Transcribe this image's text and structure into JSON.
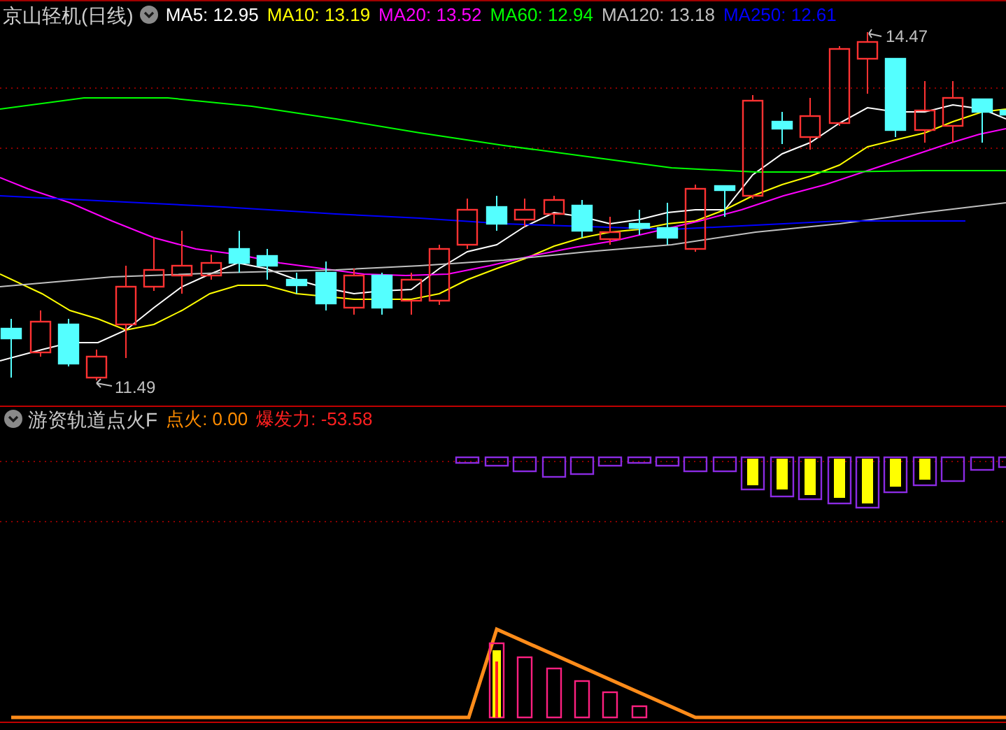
{
  "main_chart": {
    "title": "京山轻机(日线)",
    "moving_averages": [
      {
        "label": "MA5: 12.95",
        "color": "#ffffff"
      },
      {
        "label": "MA10: 13.19",
        "color": "#ffff00"
      },
      {
        "label": "MA20: 13.52",
        "color": "#ff00ff"
      },
      {
        "label": "MA60: 12.94",
        "color": "#00ff00"
      },
      {
        "label": "MA120: 13.18",
        "color": "#c0c0c0"
      },
      {
        "label": "MA250: 12.61",
        "color": "#0000ff"
      }
    ],
    "high_label": "14.47",
    "low_label": "11.49"
  },
  "indicator": {
    "title": "游资轨道点火F",
    "values": [
      {
        "label": "点火: 0.00",
        "color": "#ff8c00"
      },
      {
        "label": "爆发力: -53.58",
        "color": "#ff2020"
      }
    ]
  }
}
